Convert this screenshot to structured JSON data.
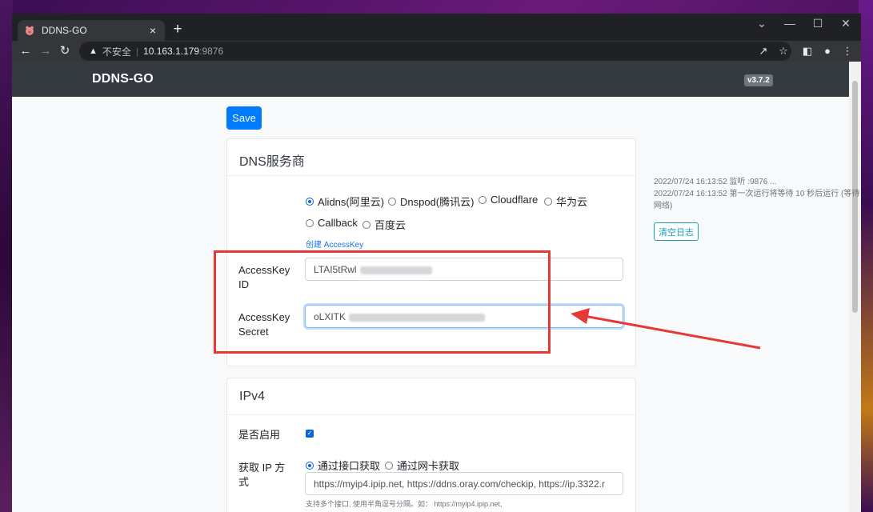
{
  "browser": {
    "tab_title": "DDNS-GO",
    "tab_close": "×",
    "new_tab": "+",
    "insecure_label": "不安全",
    "separator": "|",
    "url_host": "10.163.1.179",
    "url_port": ":9876"
  },
  "header": {
    "brand": "DDNS-GO",
    "version": "v3.7.2"
  },
  "toolbar": {
    "save_label": "Save"
  },
  "dns": {
    "title": "DNS服务商",
    "providers": [
      {
        "label": "Alidns(阿里云)",
        "checked": true
      },
      {
        "label": "Dnspod(腾讯云)",
        "checked": false
      },
      {
        "label": "Cloudflare",
        "checked": false
      },
      {
        "label": "华为云",
        "checked": false
      },
      {
        "label": "Callback",
        "checked": false
      },
      {
        "label": "百度云",
        "checked": false
      }
    ],
    "create_key_link": "创建 AccessKey",
    "access_key_id_label_1": "AccessKey",
    "access_key_id_label_2": "ID",
    "access_key_id_value": "LTAI5tRwl",
    "access_key_secret_label_1": "AccessKey",
    "access_key_secret_label_2": "Secret",
    "access_key_secret_value": "oLXITK"
  },
  "ipv4": {
    "title": "IPv4",
    "enable_label": "是否启用",
    "enabled": true,
    "method_label_1": "获取 IP 方",
    "method_label_2": "式",
    "methods": [
      {
        "label": "通过接口获取",
        "checked": true
      },
      {
        "label": "通过网卡获取",
        "checked": false
      }
    ],
    "url_value": "https://myip4.ipip.net, https://ddns.oray.com/checkip, https://ip.3322.r",
    "help_text": "支持多个接口, 使用半角逗号分隔。如： https://myip4.ipip.net,"
  },
  "logs": {
    "lines": [
      "2022/07/24 16:13:52 监听 :9876 ...",
      "2022/07/24 16:13:52 第一次运行将等待 10 秒后运行 (等待",
      "网络)"
    ],
    "clear_label": "清空日志"
  },
  "colors": {
    "accent": "#007bff",
    "highlight": "#e53935",
    "header_bg": "#343a40"
  }
}
